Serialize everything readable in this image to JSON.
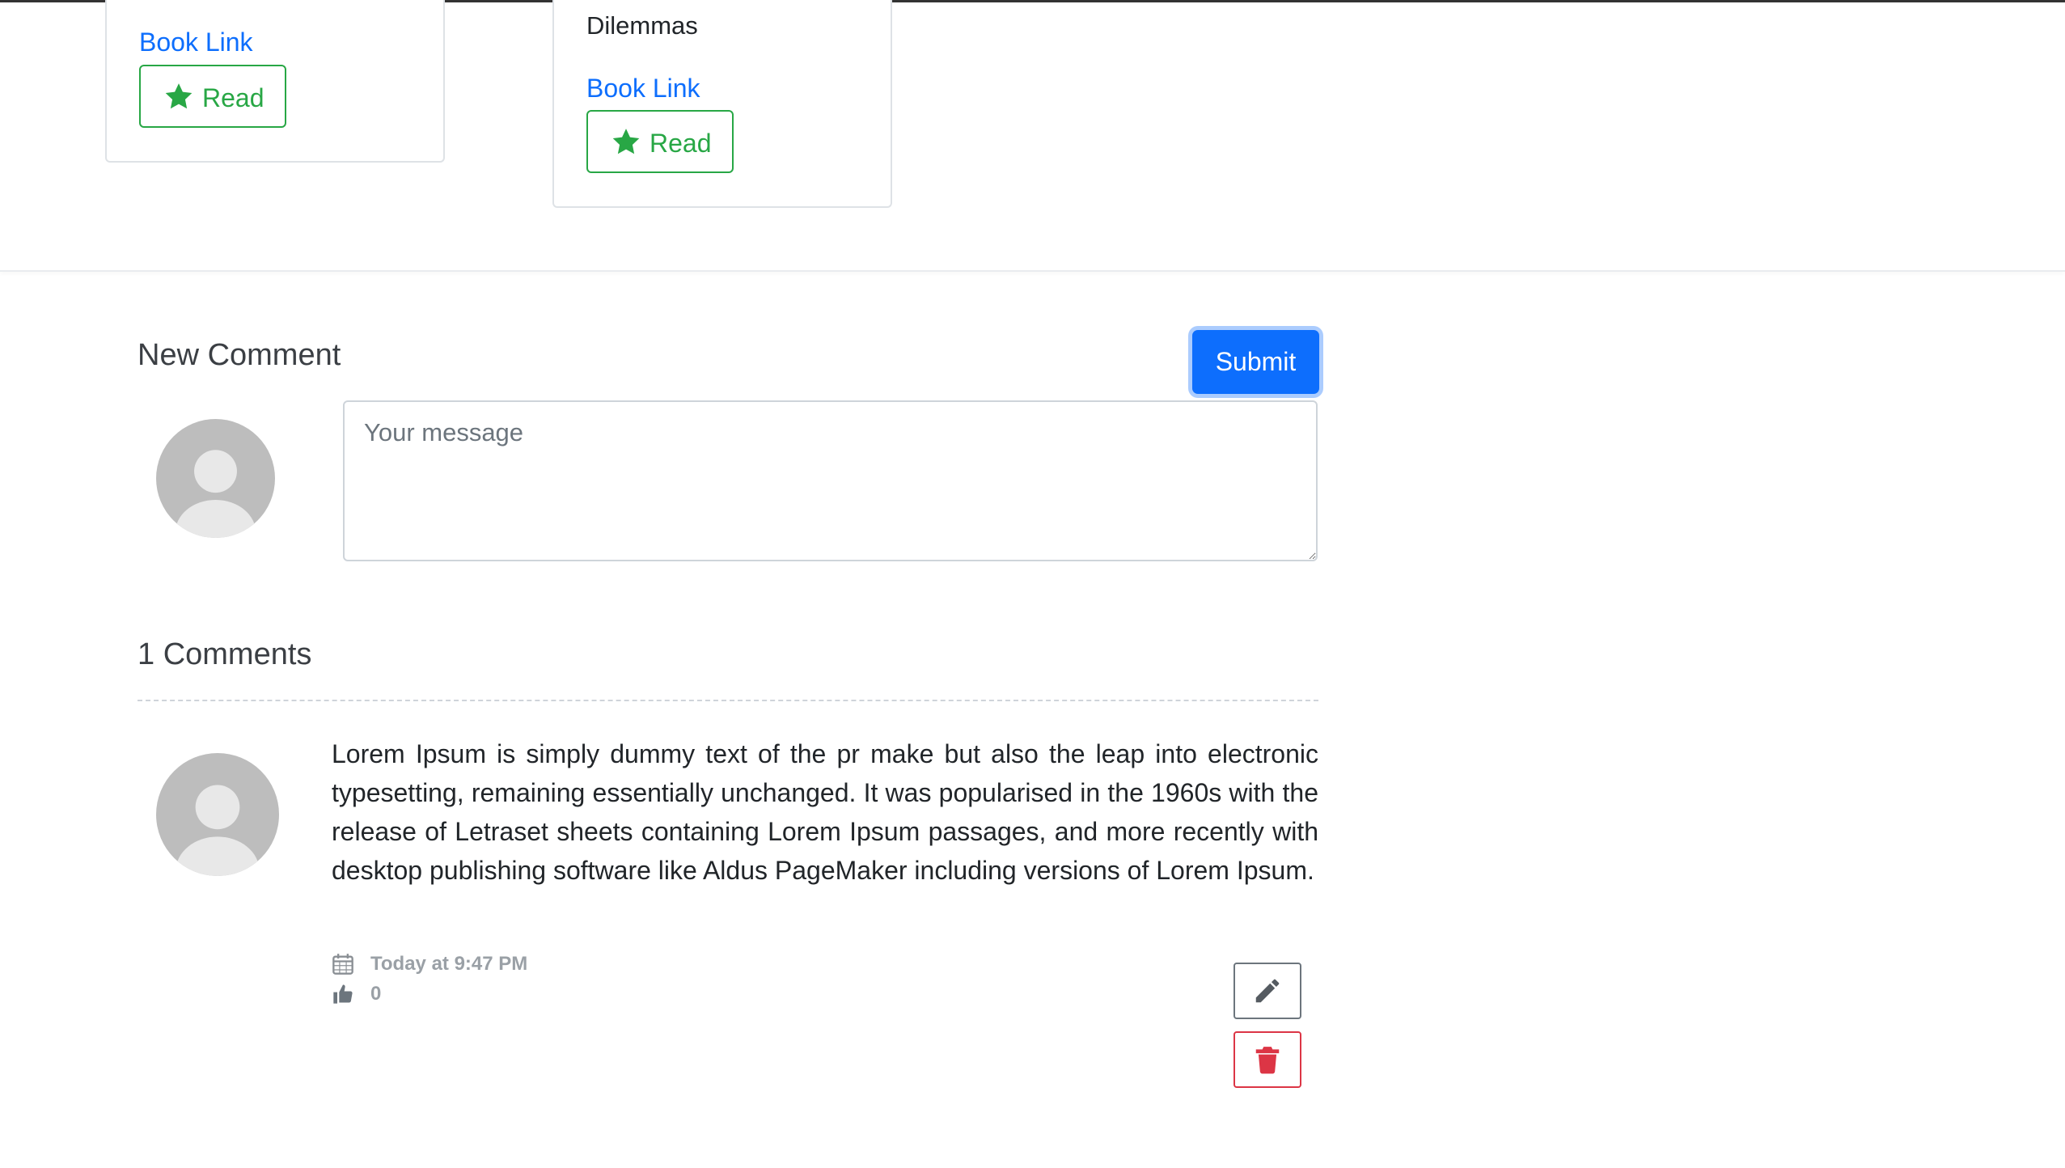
{
  "books": [
    {
      "title": "",
      "link_label": "Book Link",
      "read_label": "Read"
    },
    {
      "title": "Dilemmas",
      "link_label": "Book Link",
      "read_label": "Read"
    }
  ],
  "new_comment": {
    "heading": "New Comment",
    "submit_label": "Submit",
    "message_placeholder": "Your message",
    "message_value": ""
  },
  "comments_section": {
    "heading": "1 Comments",
    "comments": [
      {
        "text": "Lorem Ipsum is simply dummy text of the pr make but also the leap into electronic typesetting, remaining essentially unchanged. It was popularised in the 1960s with the release of Letraset sheets containing Lorem Ipsum passages, and more recently with desktop publishing software like Aldus PageMaker including versions of Lorem Ipsum.",
        "timestamp": "Today at 9:47 PM",
        "likes": "0"
      }
    ]
  },
  "icons": {
    "read": "star-icon",
    "avatar": "user-avatar-icon",
    "timestamp": "calendar-icon",
    "likes": "thumbs-up-icon",
    "edit": "pencil-icon",
    "delete": "trash-icon"
  },
  "colors": {
    "primary": "#0d6efd",
    "success": "#28a745",
    "danger": "#dc3545",
    "secondary": "#6c757d",
    "avatar_bg": "#bdbdbd"
  }
}
